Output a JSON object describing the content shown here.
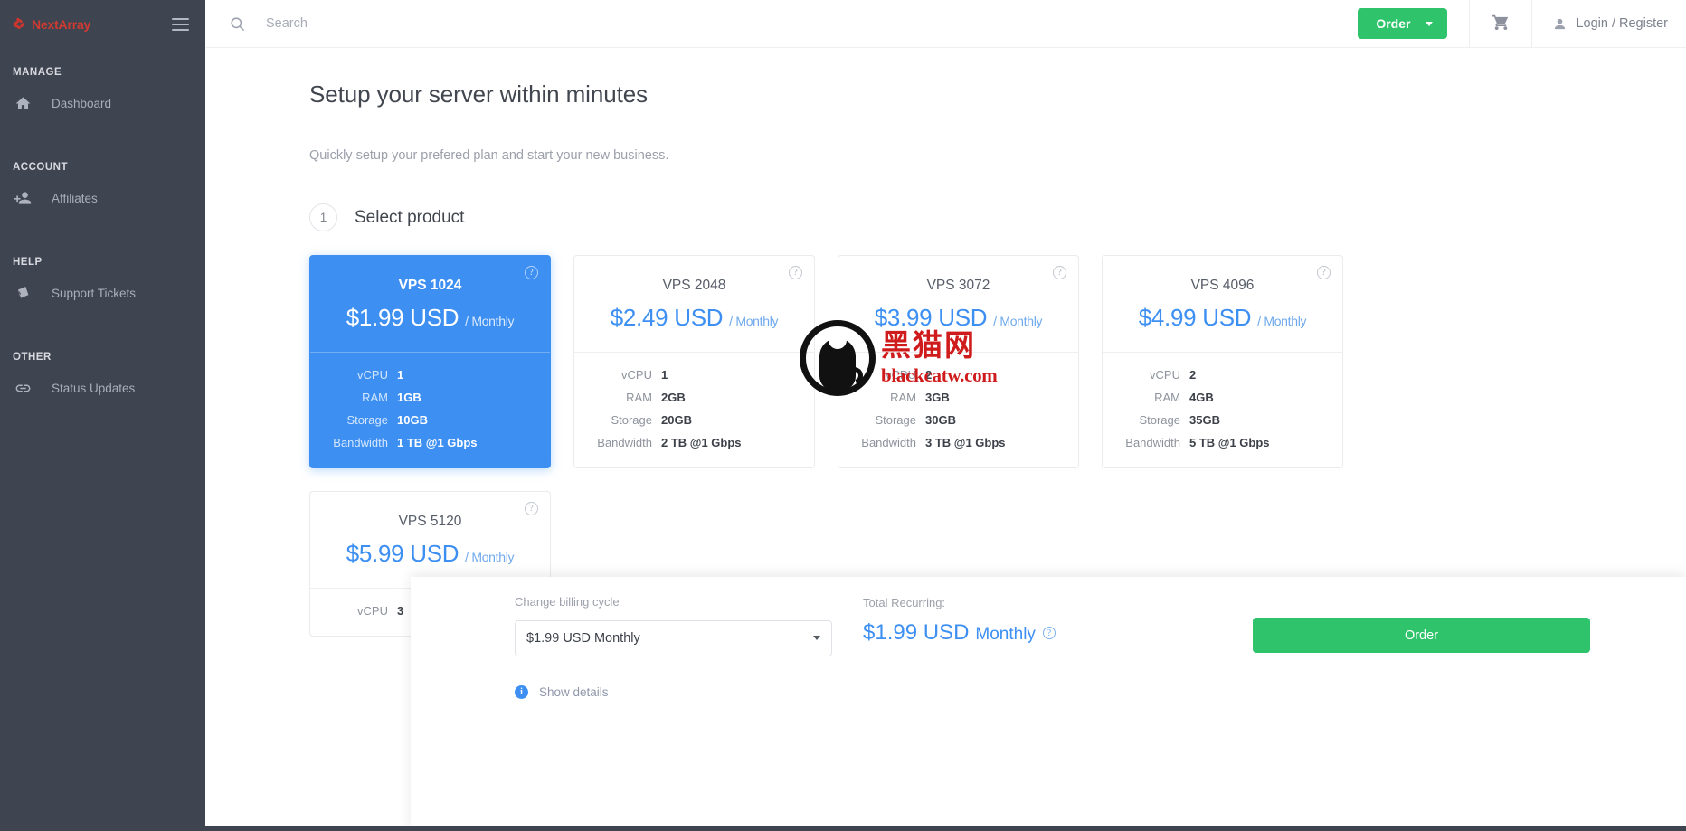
{
  "brand": {
    "name": "NextArray",
    "color": "#cf3a31"
  },
  "sidebar": {
    "sections": [
      {
        "label": "MANAGE",
        "items": [
          {
            "label": "Dashboard",
            "icon": "home-icon"
          }
        ]
      },
      {
        "label": "ACCOUNT",
        "items": [
          {
            "label": "Affiliates",
            "icon": "add-person-icon"
          }
        ]
      },
      {
        "label": "HELP",
        "items": [
          {
            "label": "Support Tickets",
            "icon": "ticket-icon"
          }
        ]
      },
      {
        "label": "OTHER",
        "items": [
          {
            "label": "Status Updates",
            "icon": "link-icon"
          }
        ]
      }
    ]
  },
  "topbar": {
    "search_placeholder": "Search",
    "search_value": "",
    "search_icon": "search-icon",
    "order_label": "Order",
    "cart_icon": "shopping-cart-icon",
    "account_icon": "person-icon",
    "account_label": "Login / Register"
  },
  "main": {
    "title": "Setup your server within minutes",
    "subtitle": "Quickly setup your prefered plan and start your new business.",
    "step_number": "1",
    "step_title": "Select product",
    "help_glyph": "?",
    "spec_labels": {
      "vcpu": "vCPU",
      "ram": "RAM",
      "storage": "Storage",
      "bandwidth": "Bandwidth"
    },
    "products": [
      {
        "name": "VPS 1024",
        "price": "$1.99 USD",
        "cycle": "/ Monthly",
        "selected": true,
        "vcpu": "1",
        "ram": "1GB",
        "storage": "10GB",
        "bandwidth": "1 TB @1 Gbps"
      },
      {
        "name": "VPS 2048",
        "price": "$2.49 USD",
        "cycle": "/ Monthly",
        "selected": false,
        "vcpu": "1",
        "ram": "2GB",
        "storage": "20GB",
        "bandwidth": "2 TB @1 Gbps"
      },
      {
        "name": "VPS 3072",
        "price": "$3.99 USD",
        "cycle": "/ Monthly",
        "selected": false,
        "vcpu": "2",
        "ram": "3GB",
        "storage": "30GB",
        "bandwidth": "3 TB @1 Gbps"
      },
      {
        "name": "VPS 4096",
        "price": "$4.99 USD",
        "cycle": "/ Monthly",
        "selected": false,
        "vcpu": "2",
        "ram": "4GB",
        "storage": "35GB",
        "bandwidth": "5 TB @1 Gbps"
      },
      {
        "name": "VPS 5120",
        "price": "$5.99 USD",
        "cycle": "/ Monthly",
        "selected": false,
        "vcpu": "3",
        "ram": "",
        "storage": "",
        "bandwidth": ""
      }
    ]
  },
  "watermark": {
    "cn": "黑猫网",
    "en": "blackcatw.com",
    "color": "#cf1b1b"
  },
  "bottombar": {
    "cycle_label": "Change billing cycle",
    "cycle_value": "$1.99 USD Monthly",
    "cycle_options": [
      "$1.99 USD Monthly"
    ],
    "total_label": "Total Recurring:",
    "total_amount": "$1.99 USD",
    "total_cycle": "Monthly",
    "total_help_glyph": "?",
    "order_label": "Order",
    "show_details_label": "Show details",
    "info_glyph": "i"
  },
  "colors": {
    "accent_blue": "#3d8ff2",
    "accent_green": "#2fc36b",
    "sidebar": "#3f4451"
  }
}
